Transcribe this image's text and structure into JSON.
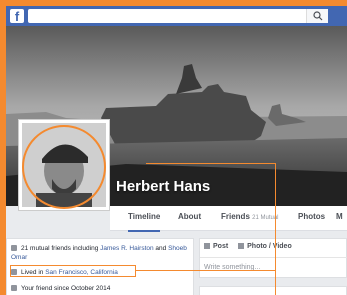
{
  "topbar": {
    "logo": "f",
    "search_placeholder": ""
  },
  "profile": {
    "name": "Herbert Hans"
  },
  "nav": {
    "timeline": "Timeline",
    "about": "About",
    "friends": "Friends",
    "friends_count": "21 Mutual",
    "photos": "Photos",
    "more": "M"
  },
  "intro": {
    "mutual_prefix": "21 mutual friends including ",
    "mutual_names_1": "James R. Hairston",
    "mutual_mid": " and ",
    "mutual_names_2": "Shoeb Omar",
    "lived_prefix": "Lived in ",
    "lived_place": "San Francisco, California",
    "friend_since": "Your friend since October 2014"
  },
  "composer": {
    "post_tab": "Post",
    "photo_tab": "Photo / Video",
    "placeholder": "Write something..."
  },
  "colors": {
    "accent": "#f48a2f",
    "fb_blue": "#4267b2"
  }
}
